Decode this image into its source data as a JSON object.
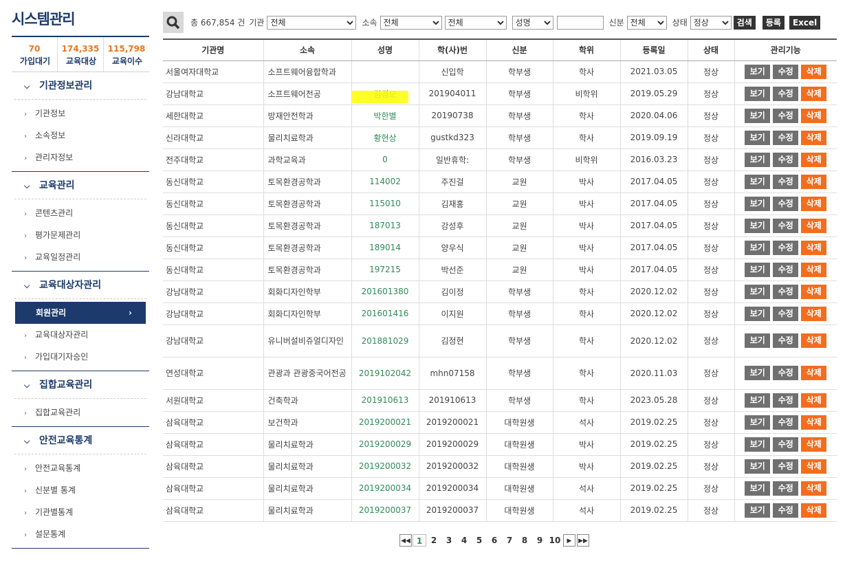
{
  "app_title": "시스템관리",
  "stats": [
    {
      "value": "70",
      "label": "가입대기"
    },
    {
      "value": "174,335",
      "label": "교육대상"
    },
    {
      "value": "115,798",
      "label": "교육이수"
    }
  ],
  "menu": [
    {
      "title": "기관정보관리",
      "items": [
        "기관정보",
        "소속정보",
        "관리자정보"
      ]
    },
    {
      "title": "교육관리",
      "items": [
        "콘텐츠관리",
        "평가문제관리",
        "교육일정관리"
      ]
    },
    {
      "title": "교육대상자관리",
      "items": [
        "회원관리",
        "교육대상자관리",
        "가입대기자승인"
      ]
    },
    {
      "title": "집합교육관리",
      "items": [
        "집합교육관리"
      ]
    },
    {
      "title": "안전교육통계",
      "items": [
        "안전교육통계",
        "신분별 통계",
        "기관별통계",
        "설문통계"
      ]
    }
  ],
  "search": {
    "total_prefix": "총",
    "total_count": "667,854",
    "total_suffix": "건",
    "inst_label": "기관",
    "inst_value": "전체",
    "dept_label": "소속",
    "dept_value": "전체",
    "dept2_value": "전체",
    "field_value": "성명",
    "keyword_value": "",
    "status_label": "신분",
    "status_value": "전체",
    "state_label": "상태",
    "state_value": "정상",
    "search_btn": "검색",
    "register_btn": "등록",
    "excel_btn": "Excel"
  },
  "table": {
    "headers": [
      "기관명",
      "소속",
      "성명",
      "학(사)번",
      "신분",
      "학위",
      "등록일",
      "상태",
      "관리기능"
    ],
    "actions": {
      "view": "보기",
      "edit": "수정",
      "delete": "삭제"
    },
    "rows": [
      [
        "서울여자대학교",
        "소프트웨어융합학과",
        "",
        "신입학",
        "학부생",
        "학사",
        "2021.03.05",
        "정상"
      ],
      [
        "강남대학교",
        "소프트웨어전공",
        "김경모",
        "201904011",
        "학부생",
        "비학위",
        "2019.05.29",
        "정상"
      ],
      [
        "세한대학교",
        "방재안전학과",
        "박한별",
        "20190738",
        "학부생",
        "학사",
        "2020.04.06",
        "정상"
      ],
      [
        "신라대학교",
        "물리치료학과",
        "황현상",
        "gustkd323",
        "학부생",
        "학사",
        "2019.09.19",
        "정상"
      ],
      [
        "전주대학교",
        "과학교육과",
        "0",
        "일반휴학:",
        "학부생",
        "비학위",
        "2016.03.23",
        "정상"
      ],
      [
        "동신대학교",
        "토목환경공학과",
        "114002",
        "주진걸",
        "교원",
        "박사",
        "2017.04.05",
        "정상"
      ],
      [
        "동신대학교",
        "토목환경공학과",
        "115010",
        "김재홍",
        "교원",
        "박사",
        "2017.04.05",
        "정상"
      ],
      [
        "동신대학교",
        "토목환경공학과",
        "187013",
        "강성후",
        "교원",
        "박사",
        "2017.04.05",
        "정상"
      ],
      [
        "동신대학교",
        "토목환경공학과",
        "189014",
        "양우식",
        "교원",
        "박사",
        "2017.04.05",
        "정상"
      ],
      [
        "동신대학교",
        "토목환경공학과",
        "197215",
        "박선준",
        "교원",
        "박사",
        "2017.04.05",
        "정상"
      ],
      [
        "강남대학교",
        "회화디자인학부",
        "201601380",
        "김이정",
        "학부생",
        "학사",
        "2020.12.02",
        "정상"
      ],
      [
        "강남대학교",
        "회화디자인학부",
        "201601416",
        "이지원",
        "학부생",
        "학사",
        "2020.12.02",
        "정상"
      ],
      [
        "강남대학교",
        "유니버설비쥬얼디자인",
        "201881029",
        "김정현",
        "학부생",
        "학사",
        "2020.12.02",
        "정상"
      ],
      [
        "연성대학교",
        "관광과 관광중국어전공",
        "2019102042",
        "mhn07158",
        "학부생",
        "학사",
        "2020.11.03",
        "정상"
      ],
      [
        "서원대학교",
        "건축학과",
        "201910613",
        "201910613",
        "학부생",
        "학사",
        "2023.05.28",
        "정상"
      ],
      [
        "삼육대학교",
        "보건학과",
        "2019200021",
        "2019200021",
        "대학원생",
        "석사",
        "2019.02.25",
        "정상"
      ],
      [
        "삼육대학교",
        "물리치료학과",
        "2019200029",
        "2019200029",
        "대학원생",
        "박사",
        "2019.02.25",
        "정상"
      ],
      [
        "삼육대학교",
        "물리치료학과",
        "2019200032",
        "2019200032",
        "대학원생",
        "박사",
        "2019.02.25",
        "정상"
      ],
      [
        "삼육대학교",
        "물리치료학과",
        "2019200034",
        "2019200034",
        "대학원생",
        "석사",
        "2019.02.25",
        "정상"
      ],
      [
        "삼육대학교",
        "물리치료학과",
        "2019200037",
        "2019200037",
        "대학원생",
        "석사",
        "2019.02.25",
        "정상"
      ]
    ]
  },
  "pagination": {
    "pages": [
      "1",
      "2",
      "3",
      "4",
      "5",
      "6",
      "7",
      "8",
      "9",
      "10"
    ],
    "current": "1"
  },
  "colors": {
    "primary": "#1c3a6b",
    "accent": "#f26d1e",
    "stat": "#e87722",
    "name_link": "#2e8b57"
  }
}
